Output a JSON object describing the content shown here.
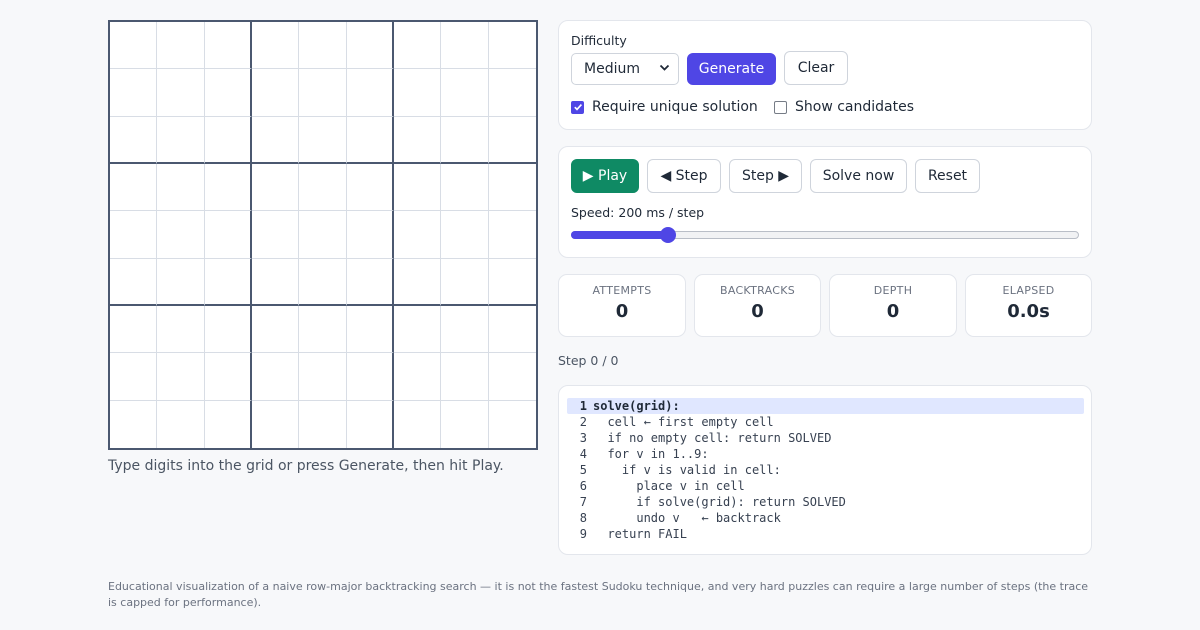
{
  "grid": {
    "size": 9,
    "cells": [
      "",
      "",
      "",
      "",
      "",
      "",
      "",
      "",
      "",
      "",
      "",
      "",
      "",
      "",
      "",
      "",
      "",
      "",
      "",
      "",
      "",
      "",
      "",
      "",
      "",
      "",
      "",
      "",
      "",
      "",
      "",
      "",
      "",
      "",
      "",
      "",
      "",
      "",
      "",
      "",
      "",
      "",
      "",
      "",
      "",
      "",
      "",
      "",
      "",
      "",
      "",
      "",
      "",
      "",
      "",
      "",
      "",
      "",
      "",
      "",
      "",
      "",
      "",
      "",
      "",
      "",
      "",
      "",
      "",
      "",
      "",
      "",
      "",
      "",
      "",
      "",
      "",
      "",
      "",
      "",
      ""
    ],
    "hint": "Type digits into the grid or press Generate, then hit Play."
  },
  "generator": {
    "difficulty_label": "Difficulty",
    "difficulty_value": "Medium",
    "generate_label": "Generate",
    "clear_label": "Clear",
    "unique_label": "Require unique solution",
    "unique_checked": true,
    "candidates_label": "Show candidates",
    "candidates_checked": false
  },
  "playback": {
    "play_label": "▶ Play",
    "step_back_label": "◀ Step",
    "step_forward_label": "Step ▶",
    "solve_now_label": "Solve now",
    "reset_label": "Reset",
    "speed_label": "Speed: 200 ms / step",
    "speed_fraction": 0.19
  },
  "stats": [
    {
      "label": "ATTEMPTS",
      "value": "0"
    },
    {
      "label": "BACKTRACKS",
      "value": "0"
    },
    {
      "label": "DEPTH",
      "value": "0"
    },
    {
      "label": "ELAPSED",
      "value": "0.0s"
    }
  ],
  "step_label": "Step 0 / 0",
  "code": {
    "active_line": 1,
    "lines": [
      {
        "num": "1",
        "text": "solve(grid):"
      },
      {
        "num": "2",
        "text": "  cell ← first empty cell"
      },
      {
        "num": "3",
        "text": "  if no empty cell: return SOLVED"
      },
      {
        "num": "4",
        "text": "  for v in 1..9:"
      },
      {
        "num": "5",
        "text": "    if v is valid in cell:"
      },
      {
        "num": "6",
        "text": "      place v in cell"
      },
      {
        "num": "7",
        "text": "      if solve(grid): return SOLVED"
      },
      {
        "num": "8",
        "text": "      undo v   ← backtrack"
      },
      {
        "num": "9",
        "text": "  return FAIL"
      }
    ]
  },
  "footer": "Educational visualization of a naive row-major backtracking search — it is not the fastest Sudoku technique, and very hard puzzles can require a large number of steps (the trace is capped for performance).",
  "colors": {
    "accent": "#4f46e5",
    "play": "#0f8a64",
    "highlight": "#e0e7ff"
  }
}
